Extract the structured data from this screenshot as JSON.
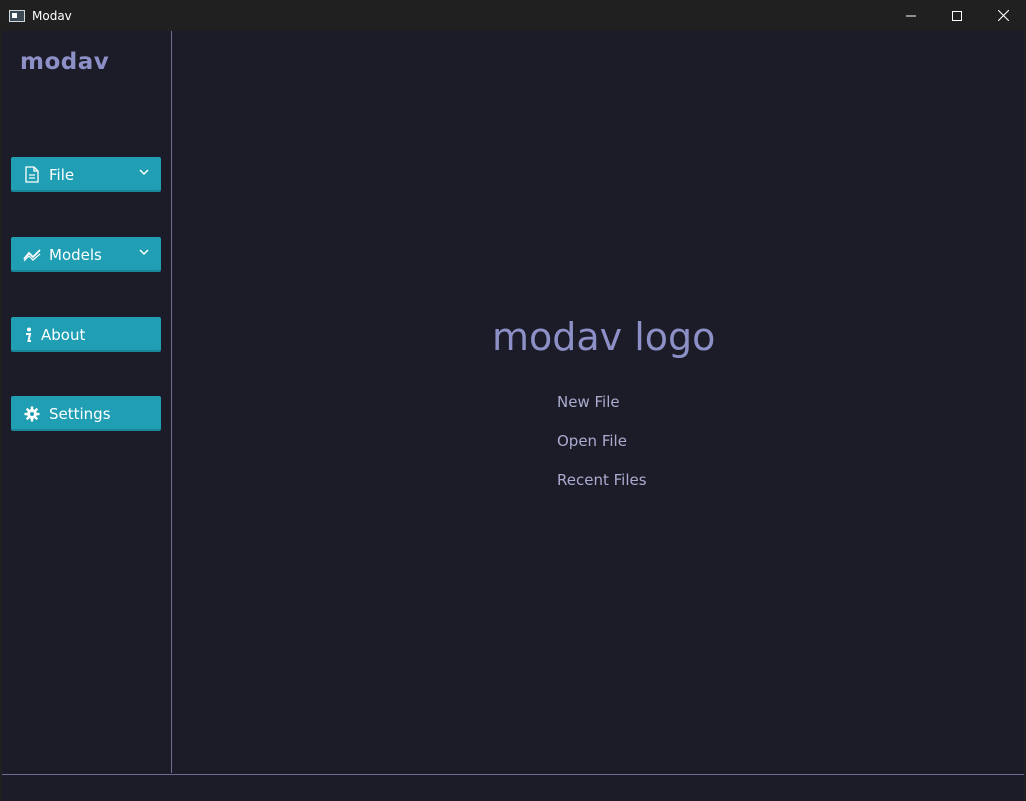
{
  "window": {
    "title": "Modav",
    "controls": [
      "minimize-icon",
      "maximize-icon",
      "close-icon"
    ]
  },
  "sidebar": {
    "brand": "modav",
    "buttons": [
      {
        "label": "File",
        "icon": "file-icon",
        "has_dropdown": true
      },
      {
        "label": "Models",
        "icon": "chart-line-icon",
        "has_dropdown": true
      },
      {
        "label": "About",
        "icon": "info-icon",
        "has_dropdown": false
      },
      {
        "label": "Settings",
        "icon": "gear-icon",
        "has_dropdown": false
      }
    ]
  },
  "main": {
    "logo_text": "modav logo",
    "links": [
      "New File",
      "Open File",
      "Recent Files"
    ]
  },
  "colors": {
    "background": "#1b1c27",
    "titlebar": "#202020",
    "button": "#1f9eb4",
    "brand": "#8d90c6",
    "link": "#a9abd0",
    "divider": "#6c6f94"
  }
}
